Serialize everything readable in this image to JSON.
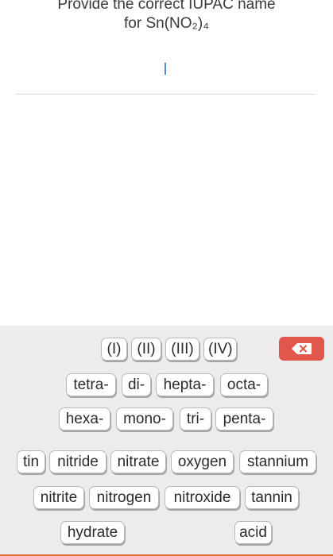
{
  "question": {
    "line1": "Provide the correct IUPAC name",
    "line2": "for Sn(NO₂)₄"
  },
  "answer": {
    "value": ""
  },
  "keyboard": {
    "delete_icon": "backspace-icon",
    "delete_color": "#e2574c",
    "rows": [
      [
        "(I)",
        "(II)",
        "(III)",
        "(IV)"
      ],
      [
        "tetra-",
        "di-",
        "hepta-",
        "octa-"
      ],
      [
        "hexa-",
        "mono-",
        "tri-",
        "penta-"
      ],
      [
        "tin",
        "nitride",
        "nitrate",
        "oxygen",
        "stannium"
      ],
      [
        "nitrite",
        "nitrogen",
        "nitroxide",
        "tannin"
      ],
      [
        "hydrate",
        "acid"
      ]
    ]
  }
}
